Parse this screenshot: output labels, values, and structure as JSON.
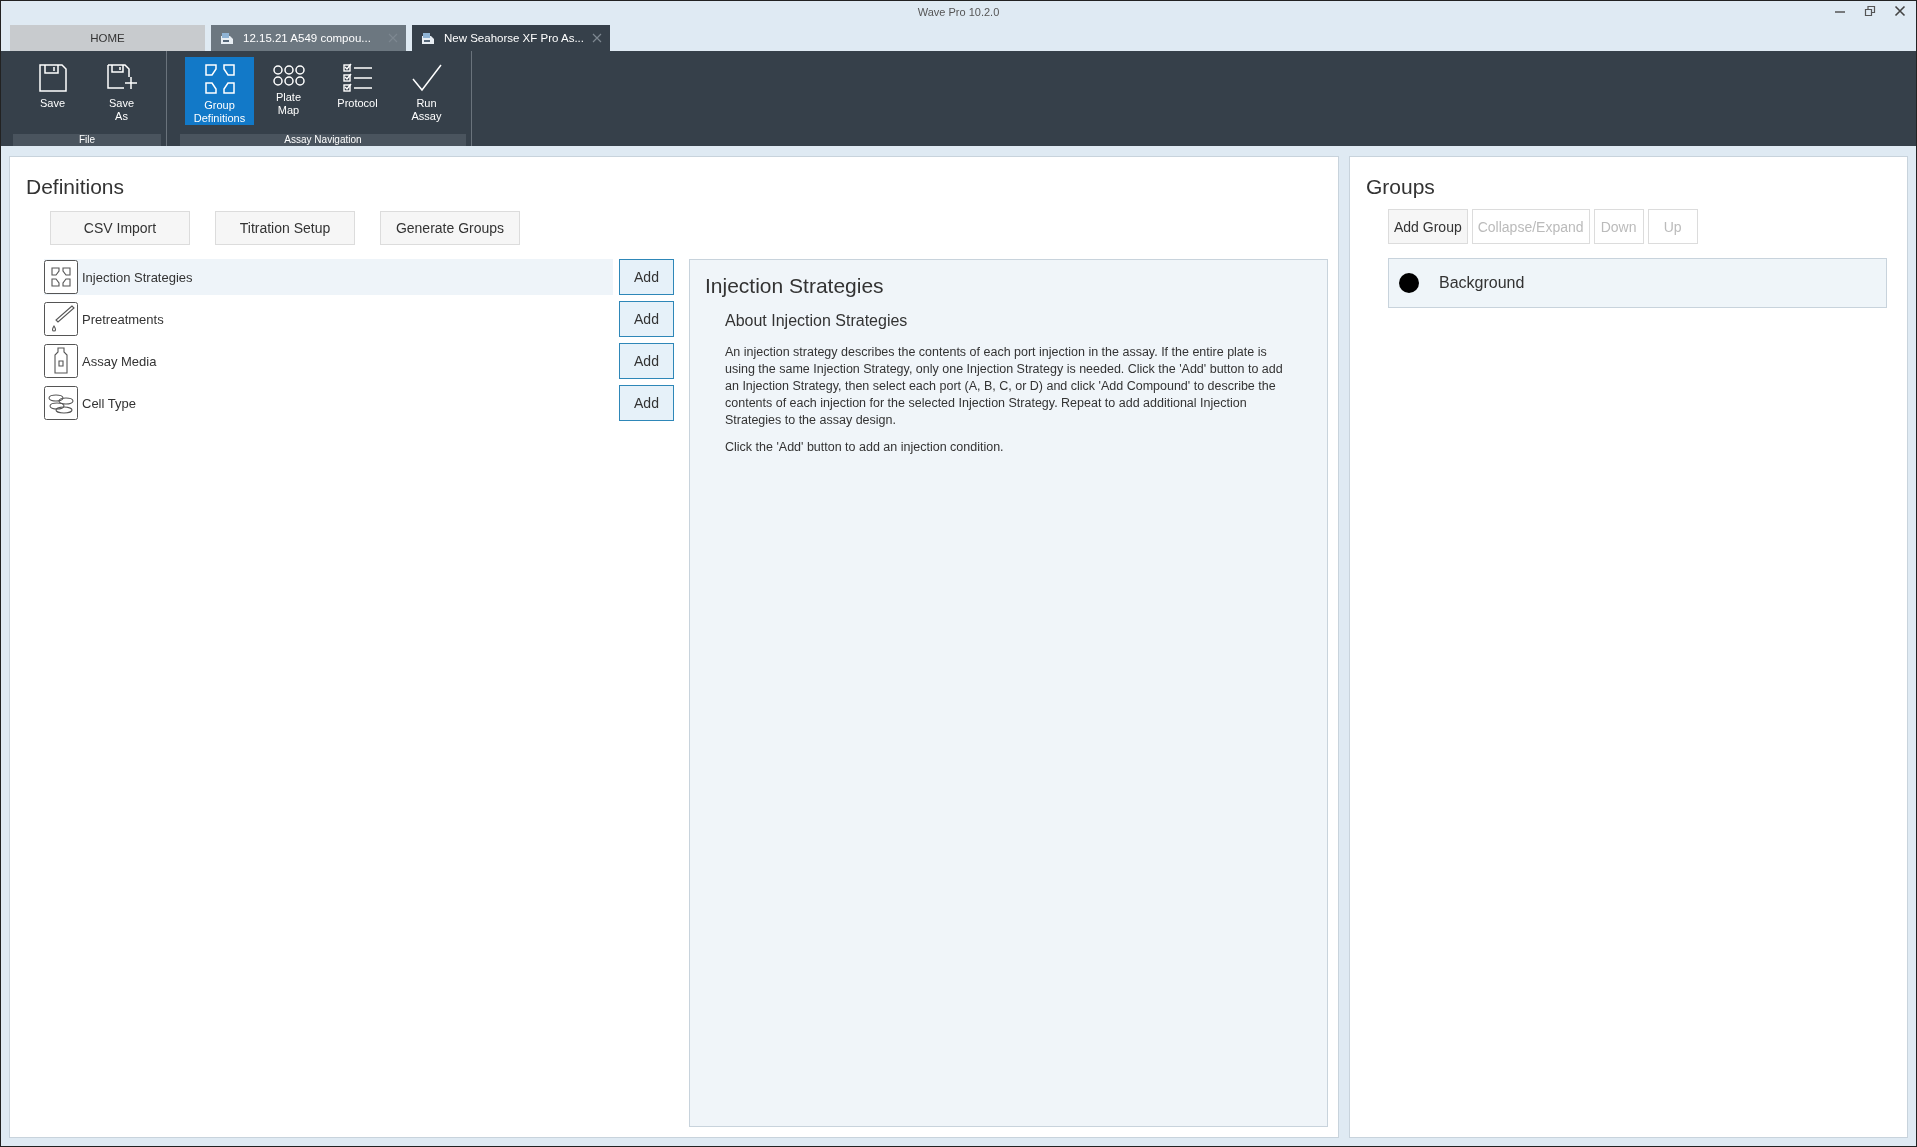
{
  "window": {
    "title": "Wave Pro 10.2.0"
  },
  "tabs": [
    {
      "label": "HOME",
      "kind": "home",
      "selected": false,
      "closable": false
    },
    {
      "label": "12.15.21 A549 compou...",
      "kind": "document",
      "selected": false,
      "closable": true
    },
    {
      "label": "New Seahorse XF Pro As...",
      "kind": "document",
      "selected": true,
      "closable": true
    }
  ],
  "ribbon": [
    {
      "label": "File",
      "buttons": [
        {
          "label": "Save",
          "kind": "save",
          "selected": false
        },
        {
          "label": "Save\nAs",
          "kind": "save-as",
          "selected": false
        }
      ]
    },
    {
      "label": "Assay Navigation",
      "buttons": [
        {
          "label": "Group\nDefinitions",
          "kind": "group-definitions",
          "selected": true
        },
        {
          "label": "Plate\nMap",
          "kind": "plate-map",
          "selected": false
        },
        {
          "label": "Protocol",
          "kind": "protocol",
          "selected": false
        },
        {
          "label": "Run\nAssay",
          "kind": "run",
          "selected": false
        }
      ]
    }
  ],
  "definitions": {
    "title": "Definitions",
    "buttons": [
      "CSV Import",
      "Titration Setup",
      "Generate Groups"
    ],
    "items": [
      {
        "label": "Injection Strategies",
        "kind": "injection",
        "selected": true,
        "action": "Add"
      },
      {
        "label": "Pretreatments",
        "kind": "pretreatment",
        "selected": false,
        "action": "Add"
      },
      {
        "label": "Assay Media",
        "kind": "media",
        "selected": false,
        "action": "Add"
      },
      {
        "label": "Cell Type",
        "kind": "cell",
        "selected": false,
        "action": "Add"
      }
    ],
    "info": {
      "title": "Injection Strategies",
      "subtitle": "About Injection Strategies",
      "paragraphs": [
        "An injection strategy describes the contents of each port injection in the assay. If the entire plate is using the same  Injection Strategy, only one Injection Strategy is needed. Click the 'Add' button to add an Injection Strategy,  then select each port (A, B, C, or D) and click 'Add Compound' to describe the contents of each injection  for the selected Injection Strategy. Repeat to add additional Injection Strategies to the assay design.",
        "Click the 'Add' button to add an injection condition."
      ]
    }
  },
  "groups": {
    "title": "Groups",
    "buttons": [
      {
        "label": "Add Group",
        "disabled": false
      },
      {
        "label": "Collapse/Expand",
        "disabled": true
      },
      {
        "label": "Down",
        "disabled": true
      },
      {
        "label": "Up",
        "disabled": true
      }
    ],
    "items": [
      {
        "name": "Background",
        "color": "#000000"
      }
    ]
  }
}
